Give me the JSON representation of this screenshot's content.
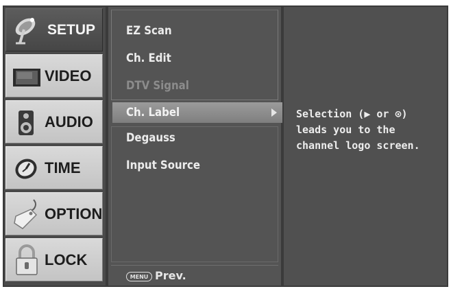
{
  "categories": [
    {
      "name": "setup",
      "label": "SETUP",
      "icon": "satellite-dish-icon",
      "active": true
    },
    {
      "name": "video",
      "label": "VIDEO",
      "icon": "monitor-icon",
      "active": false
    },
    {
      "name": "audio",
      "label": "AUDIO",
      "icon": "speaker-icon",
      "active": false
    },
    {
      "name": "time",
      "label": "TIME",
      "icon": "clock-icon",
      "active": false
    },
    {
      "name": "option",
      "label": "OPTION",
      "icon": "tag-icon",
      "active": false
    },
    {
      "name": "lock",
      "label": "LOCK",
      "icon": "padlock-icon",
      "active": false
    }
  ],
  "menu": {
    "items": [
      {
        "label": "EZ Scan",
        "enabled": true
      },
      {
        "label": "Ch. Edit",
        "enabled": true
      },
      {
        "label": "DTV Signal",
        "enabled": false
      },
      {
        "label": "Ch. Label",
        "enabled": true,
        "selected": true
      },
      {
        "label": "Degauss",
        "enabled": true
      },
      {
        "label": "Input Source",
        "enabled": true
      }
    ],
    "prev_key": "MENU",
    "prev_label": "Prev."
  },
  "help": {
    "lines": [
      "Selection (▶ or ⊙)",
      "leads you to the",
      "channel logo screen."
    ]
  },
  "colors": {
    "frame": "#3b3b3b",
    "category_inactive": "#cfcfcf",
    "category_active": "#505050",
    "highlight": "#8c8c8c",
    "text": "#ececec",
    "disabled_text": "#8c8c8c"
  }
}
